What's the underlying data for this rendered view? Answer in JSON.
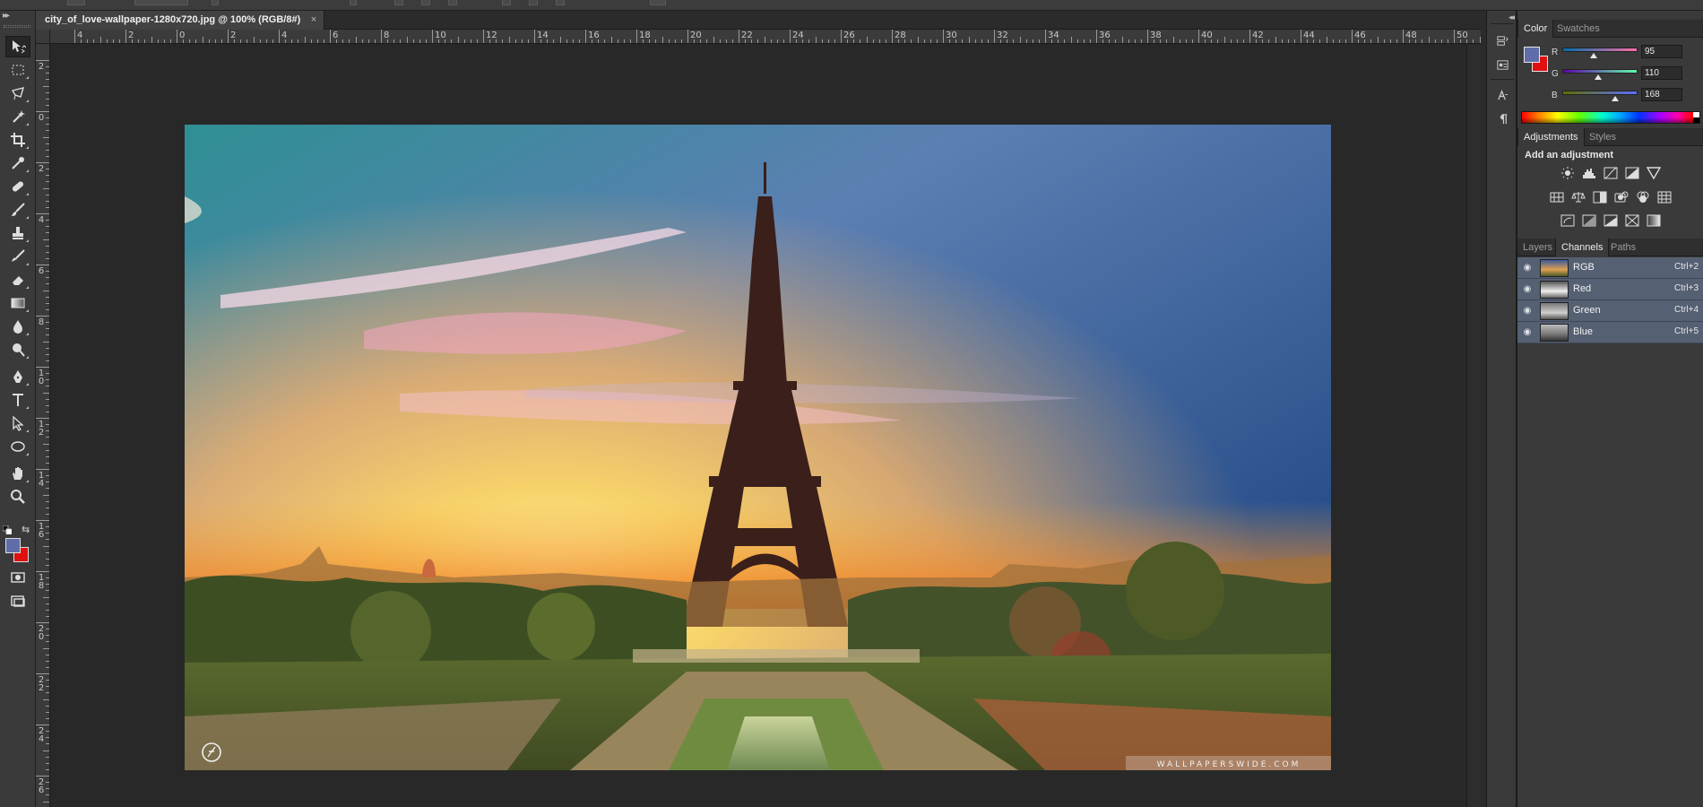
{
  "document": {
    "tab_title": "city_of_love-wallpaper-1280x720.jpg @ 100% (RGB/8#)",
    "close_glyph": "×",
    "watermark_text": "WALLPAPERSWIDE.COM"
  },
  "rulers": {
    "horizontal_labels": [
      "4",
      "2",
      "0",
      "2",
      "4",
      "6",
      "8",
      "10",
      "12",
      "14",
      "16",
      "18",
      "20",
      "22",
      "24",
      "26",
      "28",
      "30",
      "32",
      "34",
      "36",
      "38",
      "40",
      "42",
      "44",
      "46",
      "48",
      "50"
    ],
    "vertical_labels": [
      "2",
      "0",
      "2",
      "4",
      "6",
      "8",
      "10",
      "12",
      "14",
      "16",
      "18",
      "20",
      "22",
      "24",
      "26"
    ]
  },
  "tools": [
    {
      "name": "move-tool",
      "icon": "move-icon"
    },
    {
      "name": "marquee-tool",
      "icon": "rect-marquee-icon"
    },
    {
      "name": "lasso-tool",
      "icon": "lasso-icon"
    },
    {
      "name": "magic-wand-tool",
      "icon": "magic-wand-icon"
    },
    {
      "name": "crop-tool",
      "icon": "crop-icon"
    },
    {
      "name": "eyedropper-tool",
      "icon": "eyedropper-icon"
    },
    {
      "name": "healing-brush-tool",
      "icon": "healing-icon"
    },
    {
      "name": "brush-tool",
      "icon": "brush-icon"
    },
    {
      "name": "clone-stamp-tool",
      "icon": "stamp-icon"
    },
    {
      "name": "history-brush-tool",
      "icon": "history-brush-icon"
    },
    {
      "name": "eraser-tool",
      "icon": "eraser-icon"
    },
    {
      "name": "gradient-tool",
      "icon": "gradient-icon"
    },
    {
      "name": "blur-tool",
      "icon": "drop-icon"
    },
    {
      "name": "dodge-tool",
      "icon": "dodge-icon"
    },
    {
      "name": "pen-tool",
      "icon": "pen-icon"
    },
    {
      "name": "type-tool",
      "icon": "type-icon"
    },
    {
      "name": "path-selection-tool",
      "icon": "arrow-icon"
    },
    {
      "name": "shape-tool",
      "icon": "ellipse-icon"
    },
    {
      "name": "hand-tool",
      "icon": "hand-icon"
    },
    {
      "name": "zoom-tool",
      "icon": "zoom-icon"
    }
  ],
  "color_panel": {
    "tabs": [
      "Color",
      "Swatches"
    ],
    "active_tab": "Color",
    "foreground": "#5f6ea8",
    "background": "#e01010",
    "channels": [
      {
        "label": "R",
        "value": "95"
      },
      {
        "label": "G",
        "value": "110"
      },
      {
        "label": "B",
        "value": "168"
      }
    ]
  },
  "adjustments_panel": {
    "tabs": [
      "Adjustments",
      "Styles"
    ],
    "active_tab": "Adjustments",
    "title": "Add an adjustment",
    "icons": [
      "brightness-contrast-icon",
      "levels-icon",
      "curves-icon",
      "exposure-icon",
      "vibrance-icon",
      "hue-saturation-icon",
      "color-balance-icon",
      "black-white-icon",
      "photo-filter-icon",
      "channel-mixer-icon",
      "color-lookup-icon",
      "invert-icon",
      "posterize-icon",
      "threshold-icon",
      "selective-color-icon",
      "gradient-map-icon"
    ]
  },
  "channels_panel": {
    "tabs": [
      "Layers",
      "Channels",
      "Paths"
    ],
    "active_tab": "Channels",
    "rows": [
      {
        "name": "RGB",
        "shortcut": "Ctrl+2"
      },
      {
        "name": "Red",
        "shortcut": "Ctrl+3"
      },
      {
        "name": "Green",
        "shortcut": "Ctrl+4"
      },
      {
        "name": "Blue",
        "shortcut": "Ctrl+5"
      }
    ]
  },
  "dock_icons": [
    "history-icon",
    "properties-icon",
    "character-icon",
    "paragraph-icon"
  ]
}
